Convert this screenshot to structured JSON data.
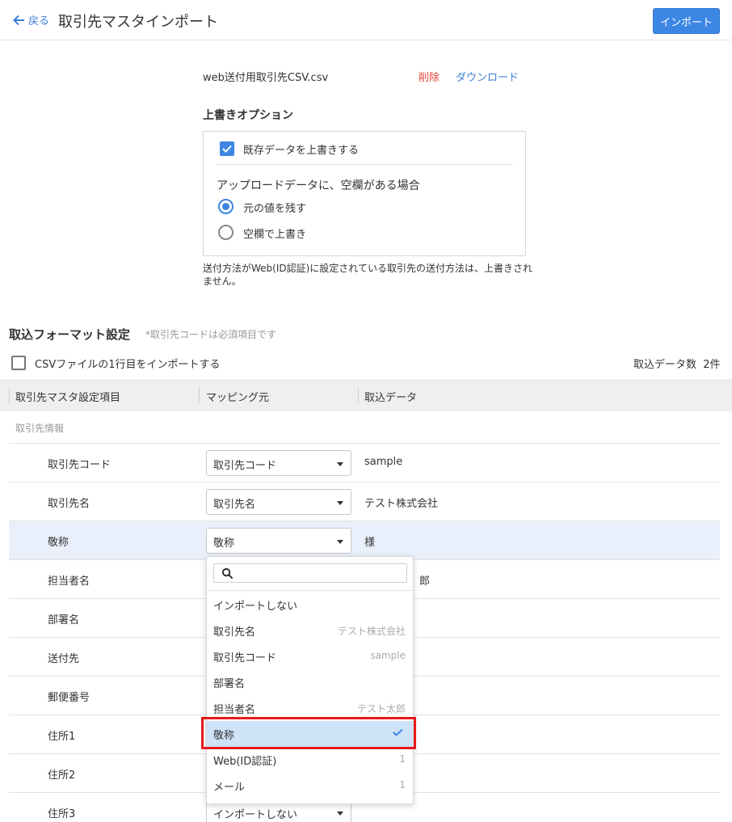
{
  "header": {
    "back_label": "戻る",
    "title": "取引先マスタインポート",
    "import_button": "インポート"
  },
  "file": {
    "name": "web送付用取引先CSV.csv",
    "delete_label": "削除",
    "download_label": "ダウンロード"
  },
  "overwrite": {
    "title": "上書きオプション",
    "checkbox_label": "既存データを上書きする",
    "checkbox_checked": true,
    "blank_title": "アップロードデータに、空欄がある場合",
    "options": [
      "元の値を残す",
      "空欄で上書き"
    ],
    "selected_option": "元の値を残す",
    "note": "送付方法がWeb(ID認証)に設定されている取引先の送付方法は、上書きされません。"
  },
  "format": {
    "title": "取込フォーマット設定",
    "required_note": "*取引先コードは必須項目です",
    "first_row_label": "CSVファイルの1行目をインポートする",
    "first_row_checked": false,
    "count_label": "取込データ数",
    "count_value": "2件",
    "columns": [
      "取引先マスタ設定項目",
      "マッピング元",
      "取込データ"
    ],
    "group_label": "取引先情報",
    "rows": [
      {
        "label": "取引先コード",
        "mapping": "取引先コード",
        "data": "sample"
      },
      {
        "label": "取引先名",
        "mapping": "取引先名",
        "data": "テスト株式会社"
      },
      {
        "label": "敬称",
        "mapping": "敬称",
        "data": "様"
      },
      {
        "label": "担当者名",
        "mapping": "",
        "data": "郎"
      },
      {
        "label": "部署名",
        "mapping": "",
        "data": ""
      },
      {
        "label": "送付先",
        "mapping": "",
        "data": ""
      },
      {
        "label": "郵便番号",
        "mapping": "",
        "data": ""
      },
      {
        "label": "住所1",
        "mapping": "",
        "data": ""
      },
      {
        "label": "住所2",
        "mapping": "",
        "data": ""
      },
      {
        "label": "住所3",
        "mapping": "インポートしない",
        "data": ""
      }
    ]
  },
  "dropdown": {
    "search_placeholder": "",
    "items": [
      {
        "label": "インポートしない",
        "hint": ""
      },
      {
        "label": "取引先名",
        "hint": "テスト株式会社"
      },
      {
        "label": "取引先コード",
        "hint": "sample"
      },
      {
        "label": "部署名",
        "hint": ""
      },
      {
        "label": "担当者名",
        "hint": "テスト太郎"
      },
      {
        "label": "敬称",
        "hint": ""
      },
      {
        "label": "Web(ID認証)",
        "hint": "1"
      },
      {
        "label": "メール",
        "hint": "1"
      }
    ],
    "selected": "敬称"
  },
  "colors": {
    "primary": "#3d86e3",
    "link": "#3d7fd6",
    "danger": "#e0463b",
    "highlight_border": "#e8191c",
    "row_active": "#e9f0fb",
    "item_selected": "#cfe3f8"
  }
}
